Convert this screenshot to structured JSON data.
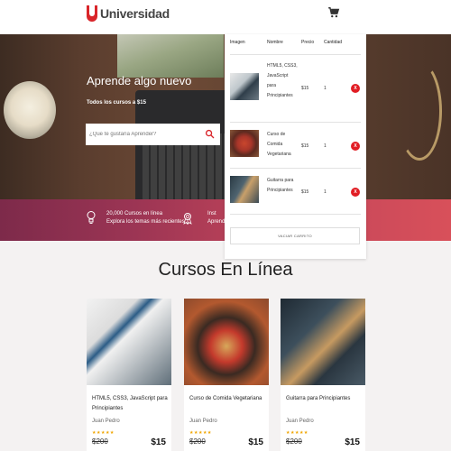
{
  "header": {
    "logo_text": "Universidad"
  },
  "hero": {
    "title": "Aprende algo nuevo",
    "subtitle": "Todos los cursos a $15",
    "search_placeholder": "¿Que te gustaría Aprender?"
  },
  "infobar": {
    "items": [
      {
        "line1": "20,000 Cursos en línea",
        "line2": "Explora los temas más recientes"
      },
      {
        "line1": "Inst",
        "line2": "Aprend"
      }
    ]
  },
  "cart": {
    "columns": [
      "Imagen",
      "Nombre",
      "Precio",
      "Cantidad"
    ],
    "items": [
      {
        "name": "HTML5, CSS3, JavaScript para Principiantes",
        "price": "$15",
        "qty": "1",
        "remove": "X"
      },
      {
        "name": "Curso de Comida Vegetariana",
        "price": "$15",
        "qty": "1",
        "remove": "X"
      },
      {
        "name": "Guitarra para Principiantes",
        "price": "$15",
        "qty": "1",
        "remove": "X"
      }
    ],
    "empty_label": "VACIAR CARRITO"
  },
  "courses": {
    "title": "Cursos En Línea",
    "cards": [
      {
        "title": "HTML5, CSS3, JavaScript para Principiantes",
        "author": "Juan Pedro",
        "stars": "★★★★★",
        "old_price": "$200",
        "price": "$15"
      },
      {
        "title": "Curso de Comida Vegetariana",
        "author": "Juan Pedro",
        "stars": "★★★★★",
        "old_price": "$200",
        "price": "$15"
      },
      {
        "title": "Guitarra para Principiantes",
        "author": "Juan Pedro",
        "stars": "★★★★★",
        "old_price": "$200",
        "price": "$15"
      }
    ]
  },
  "colors": {
    "brand_red": "#d9252a",
    "remove_red": "#e11d24",
    "star": "#f0a500"
  },
  "icons": [
    "logo-mark-icon",
    "cart-icon",
    "search-icon",
    "bulb-icon",
    "award-icon"
  ]
}
